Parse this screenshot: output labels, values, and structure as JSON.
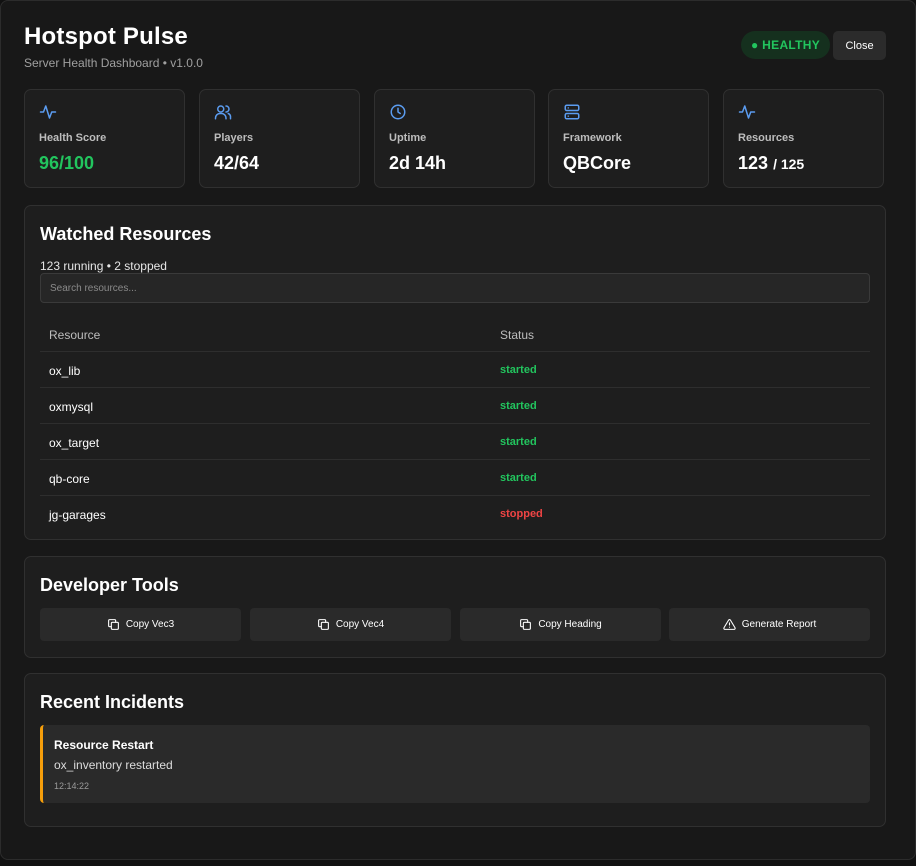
{
  "header": {
    "title": "Hotspot Pulse",
    "subtitle": "Server Health Dashboard • v1.0.0",
    "status_badge": "● HEALTHY",
    "close_label": "Close"
  },
  "stats": [
    {
      "label": "Health Score",
      "value": "96/100",
      "icon": "activity-icon"
    },
    {
      "label": "Players",
      "value": "42/64",
      "icon": "users-icon"
    },
    {
      "label": "Uptime",
      "value": "2d 14h",
      "icon": "clock-icon"
    },
    {
      "label": "Framework",
      "value": "QBCore",
      "icon": "server-icon"
    },
    {
      "label": "Resources",
      "value": "123",
      "value_total": "/ 125",
      "icon": "activity-icon"
    }
  ],
  "resources": {
    "title": "Watched Resources",
    "summary": "123 running • 2 stopped",
    "search_placeholder": "Search resources...",
    "columns": [
      "Resource",
      "Status"
    ],
    "rows": [
      {
        "name": "ox_lib",
        "status": "started"
      },
      {
        "name": "oxmysql",
        "status": "started"
      },
      {
        "name": "ox_target",
        "status": "started"
      },
      {
        "name": "qb-core",
        "status": "started"
      },
      {
        "name": "jg-garages",
        "status": "stopped"
      }
    ]
  },
  "tools": {
    "title": "Developer Tools",
    "buttons": [
      {
        "label": "Copy Vec3",
        "icon": "copy-icon"
      },
      {
        "label": "Copy Vec4",
        "icon": "copy-icon"
      },
      {
        "label": "Copy Heading",
        "icon": "copy-icon"
      },
      {
        "label": "Generate Report",
        "icon": "warning-icon"
      }
    ]
  },
  "incidents": {
    "title": "Recent Incidents",
    "items": [
      {
        "title": "Resource Restart",
        "message": "ox_inventory restarted",
        "time": "12:14:22"
      }
    ]
  },
  "colors": {
    "accent_icon": "#5b9cf0",
    "healthy": "#22c55e",
    "stopped": "#ef4444",
    "incident_warning": "#f59e0b"
  }
}
